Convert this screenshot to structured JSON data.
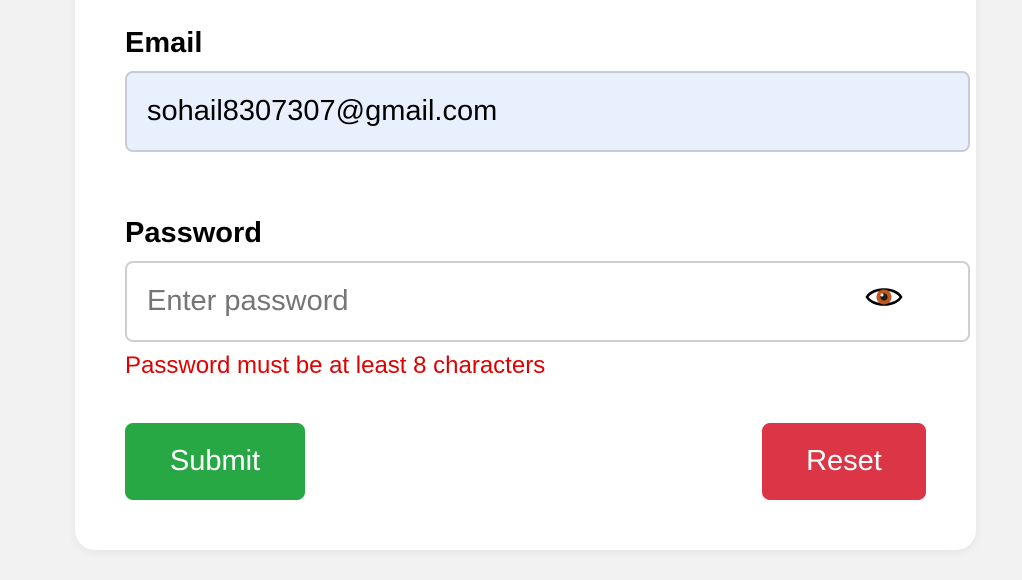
{
  "form": {
    "email": {
      "label": "Email",
      "value": "sohail8307307@gmail.com"
    },
    "password": {
      "label": "Password",
      "value": "",
      "placeholder": "Enter password",
      "toggle_icon": "eye-icon",
      "error": "Password must be at least 8 characters"
    },
    "buttons": {
      "submit_label": "Submit",
      "reset_label": "Reset"
    }
  },
  "colors": {
    "submit": "#28a745",
    "reset": "#dc3545",
    "error": "#e00000",
    "autofill_bg": "#e8f0fe"
  }
}
